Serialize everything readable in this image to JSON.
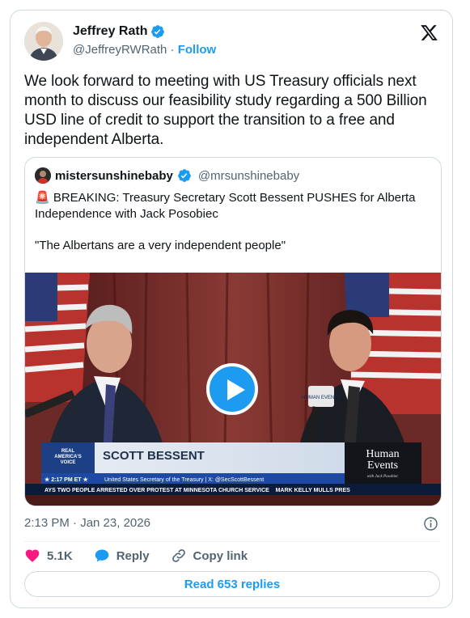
{
  "author": {
    "name": "Jeffrey Rath",
    "handle": "@JeffreyRWRath",
    "separator": "·",
    "follow_label": "Follow",
    "verified": true
  },
  "tweet": {
    "text": "We look forward to meeting with US Treasury officials next month to discuss our feasibility study regarding a 500 Billion USD line of credit to support the transition to a free and independent Alberta."
  },
  "quote": {
    "name": "mistersunshinebaby",
    "handle": "@mrsunshinebaby",
    "line1": "🚨 BREAKING: Treasury Secretary Scott Bessent PUSHES for Alberta Independence with Jack Posobiec",
    "line2": "\"The Albertans are a very independent people\"",
    "video": {
      "network_label_1": "REAL",
      "network_label_2": "AMERICA'S",
      "network_label_3": "VOICE",
      "time": "★ 2:17 PM ET ★",
      "name_banner": "SCOTT BESSENT",
      "title_banner": "United States Secretary of the Treasury | X: @SecScottBessent",
      "ticker": "AYS TWO PEOPLE ARRESTED OVER PROTEST AT MINNESOTA CHURCH SERVICE    MARK KELLY MULLS PRES",
      "logo_line1": "Human",
      "logo_line2": "Events",
      "logo_sub": "with Jack Posobiec",
      "mic_label": "HUMAN EVENTS"
    }
  },
  "timestamp": "2:13 PM · Jan 23, 2026",
  "actions": {
    "likes": "5.1K",
    "reply": "Reply",
    "copy_link": "Copy link"
  },
  "read_replies": "Read 653 replies",
  "colors": {
    "accent": "#1d9bf0",
    "like": "#f91880",
    "text": "#0f1419",
    "muted": "#536471",
    "border": "#cfd9de"
  }
}
